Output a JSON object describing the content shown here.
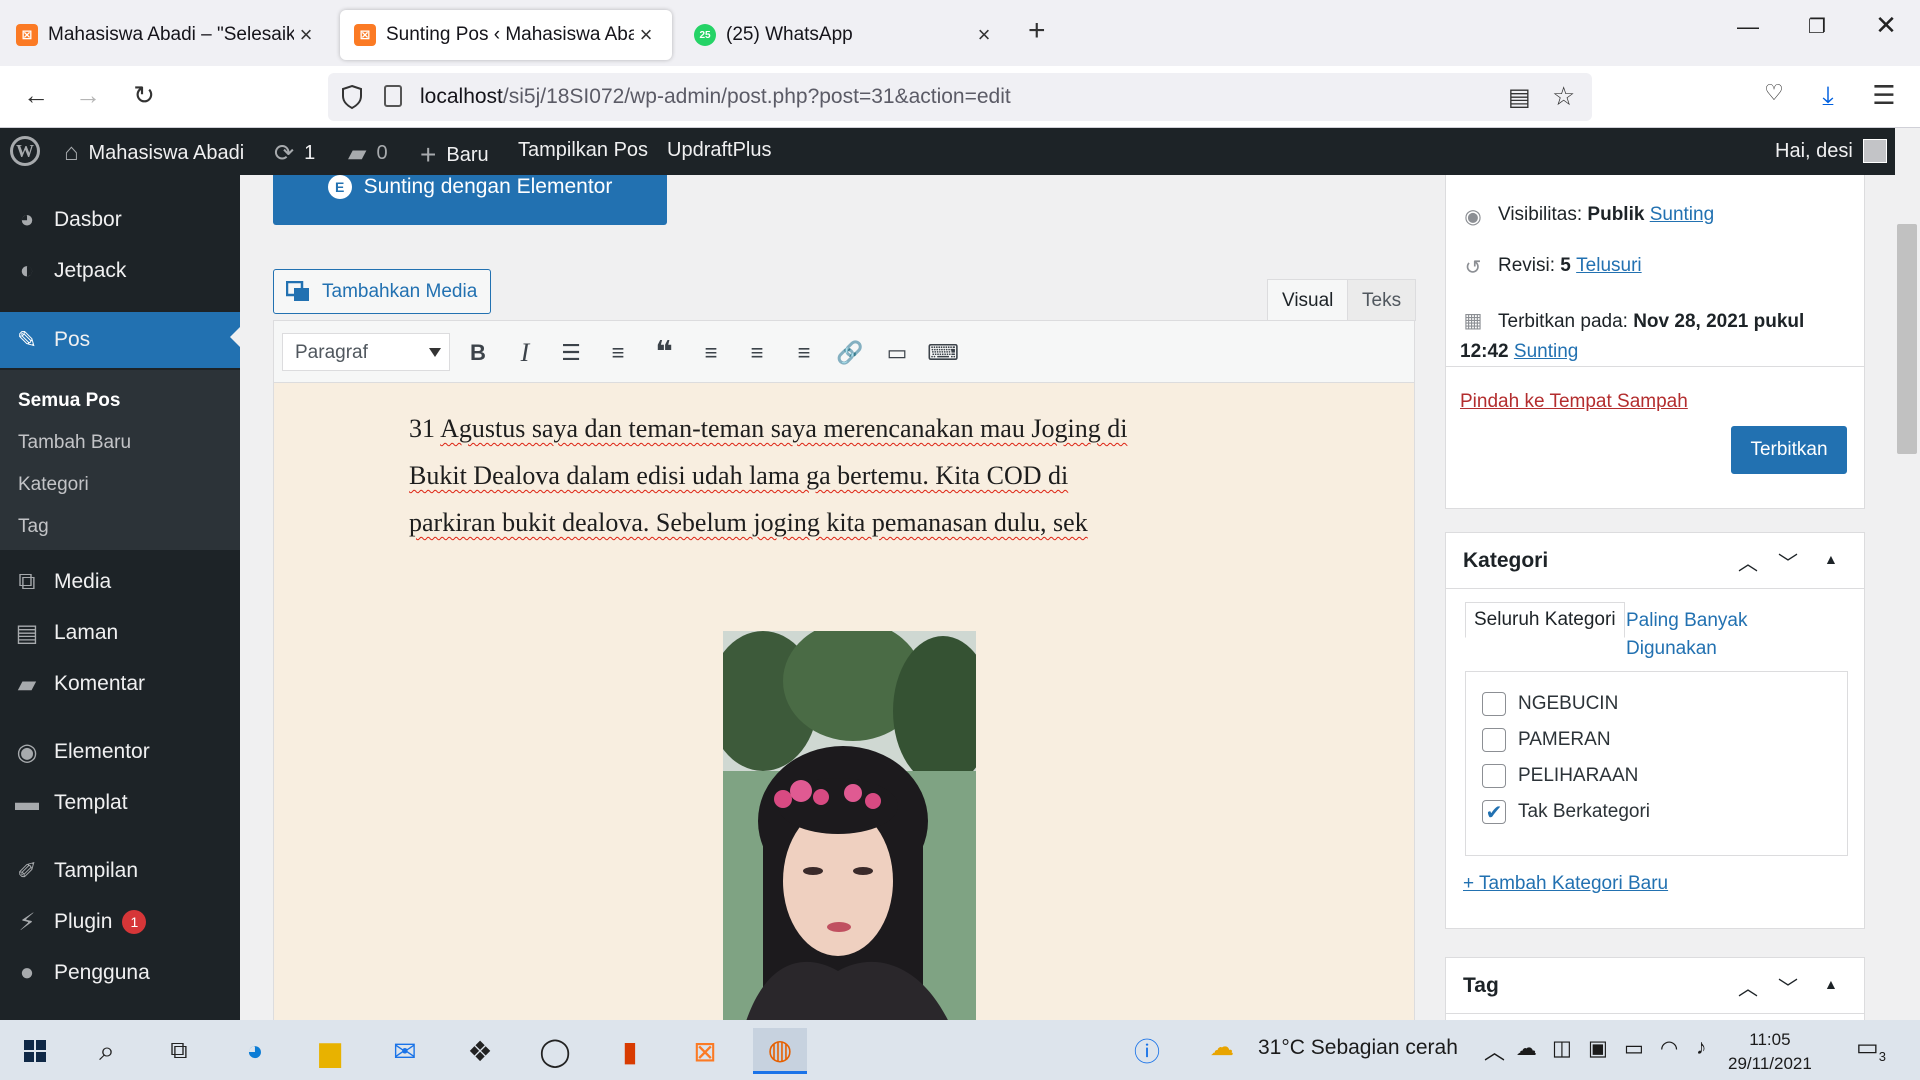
{
  "browser": {
    "tabs": [
      {
        "title": "Mahasiswa Abadi – \"Selesaikan",
        "icon": "xampp-icon"
      },
      {
        "title": "Sunting Pos ‹ Mahasiswa Abadi",
        "icon": "xampp-icon"
      },
      {
        "title": "(25) WhatsApp",
        "icon": "whatsapp-icon",
        "badge": "25"
      }
    ],
    "url_host": "localhost",
    "url_path": "/si5j/18SI072/wp-admin/post.php?post=31&action=edit"
  },
  "adminbar": {
    "site_name": "Mahasiswa Abadi",
    "updates_count": "1",
    "comments_count": "0",
    "new_label": "Baru",
    "view_post": "Tampilkan Pos",
    "plugin": "UpdraftPlus",
    "greeting": "Hai, desi"
  },
  "sidebar": {
    "items": [
      {
        "label": "Dasbor",
        "icon": "dashboard-icon"
      },
      {
        "label": "Jetpack",
        "icon": "jetpack-icon"
      },
      {
        "label": "Pos",
        "icon": "pin-icon"
      },
      {
        "label": "Media",
        "icon": "media-icon"
      },
      {
        "label": "Laman",
        "icon": "page-icon"
      },
      {
        "label": "Komentar",
        "icon": "comment-icon"
      },
      {
        "label": "Elementor",
        "icon": "elementor-icon"
      },
      {
        "label": "Templat",
        "icon": "folder-icon"
      },
      {
        "label": "Tampilan",
        "icon": "brush-icon"
      },
      {
        "label": "Plugin",
        "icon": "plugin-icon",
        "badge": "1"
      },
      {
        "label": "Pengguna",
        "icon": "user-icon"
      }
    ],
    "submenu": [
      "Semua Pos",
      "Tambah Baru",
      "Kategori",
      "Tag"
    ]
  },
  "editor": {
    "elementor_button": "Sunting dengan Elementor",
    "add_media": "Tambahkan Media",
    "tab_visual": "Visual",
    "tab_text": "Teks",
    "format": "Paragraf",
    "content_line1_a": "31 ",
    "content_line1_b": "Agustus saya dan teman-teman saya merencanakan mau Joging di",
    "content_line2": "Bukit Dealova dalam edisi udah lama ga bertemu. Kita COD di",
    "content_line3": "parkiran bukit dealova. Sebelum joging kita pemanasan dulu, sek"
  },
  "publish": {
    "visibility_label": "Visibilitas:",
    "visibility_value": "Publik",
    "visibility_link": "Sunting",
    "revisions_label": "Revisi:",
    "revisions_value": "5",
    "revisions_link": "Telusuri",
    "published_label": "Terbitkan pada:",
    "published_value_1": "Nov 28, 2021 pukul",
    "published_value_2": "12:42",
    "published_link": "Sunting",
    "trash": "Pindah ke Tempat Sampah",
    "button": "Terbitkan"
  },
  "categories": {
    "title": "Kategori",
    "tab_all": "Seluruh Kategori",
    "tab_popular": "Paling Banyak Digunakan",
    "items": [
      {
        "label": "NGEBUCIN",
        "checked": false
      },
      {
        "label": "PAMERAN",
        "checked": false
      },
      {
        "label": "PELIHARAAN",
        "checked": false
      },
      {
        "label": "Tak Berkategori",
        "checked": true
      }
    ],
    "add_new": "+ Tambah Kategori Baru"
  },
  "tags": {
    "title": "Tag"
  },
  "taskbar": {
    "weather": "31°C  Sebagian cerah",
    "time": "11:05",
    "date": "29/11/2021",
    "notifications": "3"
  },
  "colors": {
    "wp_blue": "#2271b1",
    "admin_dark": "#1d2327",
    "editor_bg": "#f8eee0"
  }
}
